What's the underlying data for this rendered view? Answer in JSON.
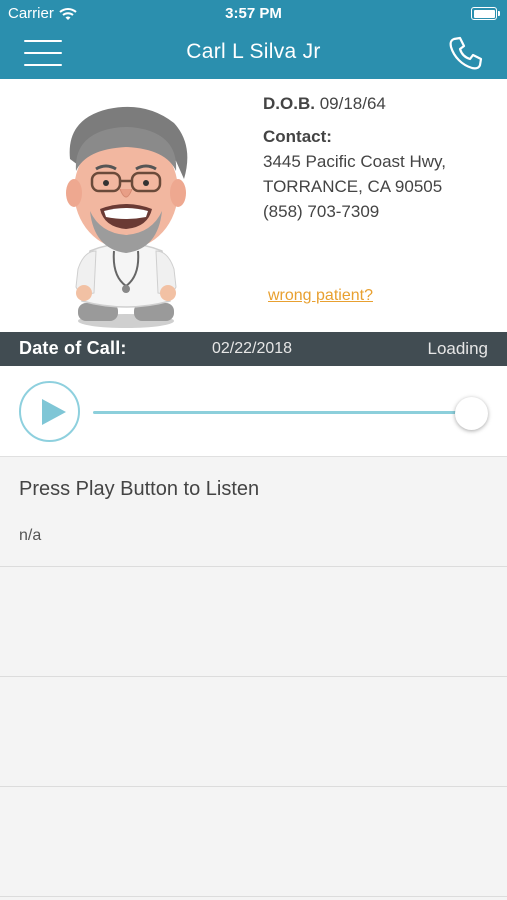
{
  "status_bar": {
    "carrier": "Carrier",
    "time": "3:57 PM"
  },
  "nav": {
    "title": "Carl L Silva Jr"
  },
  "patient": {
    "dob_label": "D.O.B.",
    "dob": "09/18/64",
    "contact_label": "Contact:",
    "address_line1": "3445 Pacific Coast Hwy,",
    "address_line2": "TORRANCE, CA 90505",
    "phone": "(858) 703-7309",
    "wrong_patient_link": "wrong patient?"
  },
  "call": {
    "date_label": "Date of Call:",
    "date": "02/22/2018",
    "status": "Loading"
  },
  "player": {
    "progress": 1.0
  },
  "transcript": {
    "title": "Press Play Button to Listen",
    "body": "n/a"
  },
  "colors": {
    "header": "#2b8fae",
    "date_bar": "#414c52",
    "link": "#e8a030",
    "accent": "#8ccfdb"
  },
  "icons": [
    "wifi-icon",
    "battery-icon",
    "menu-icon",
    "phone-icon",
    "play-icon"
  ]
}
